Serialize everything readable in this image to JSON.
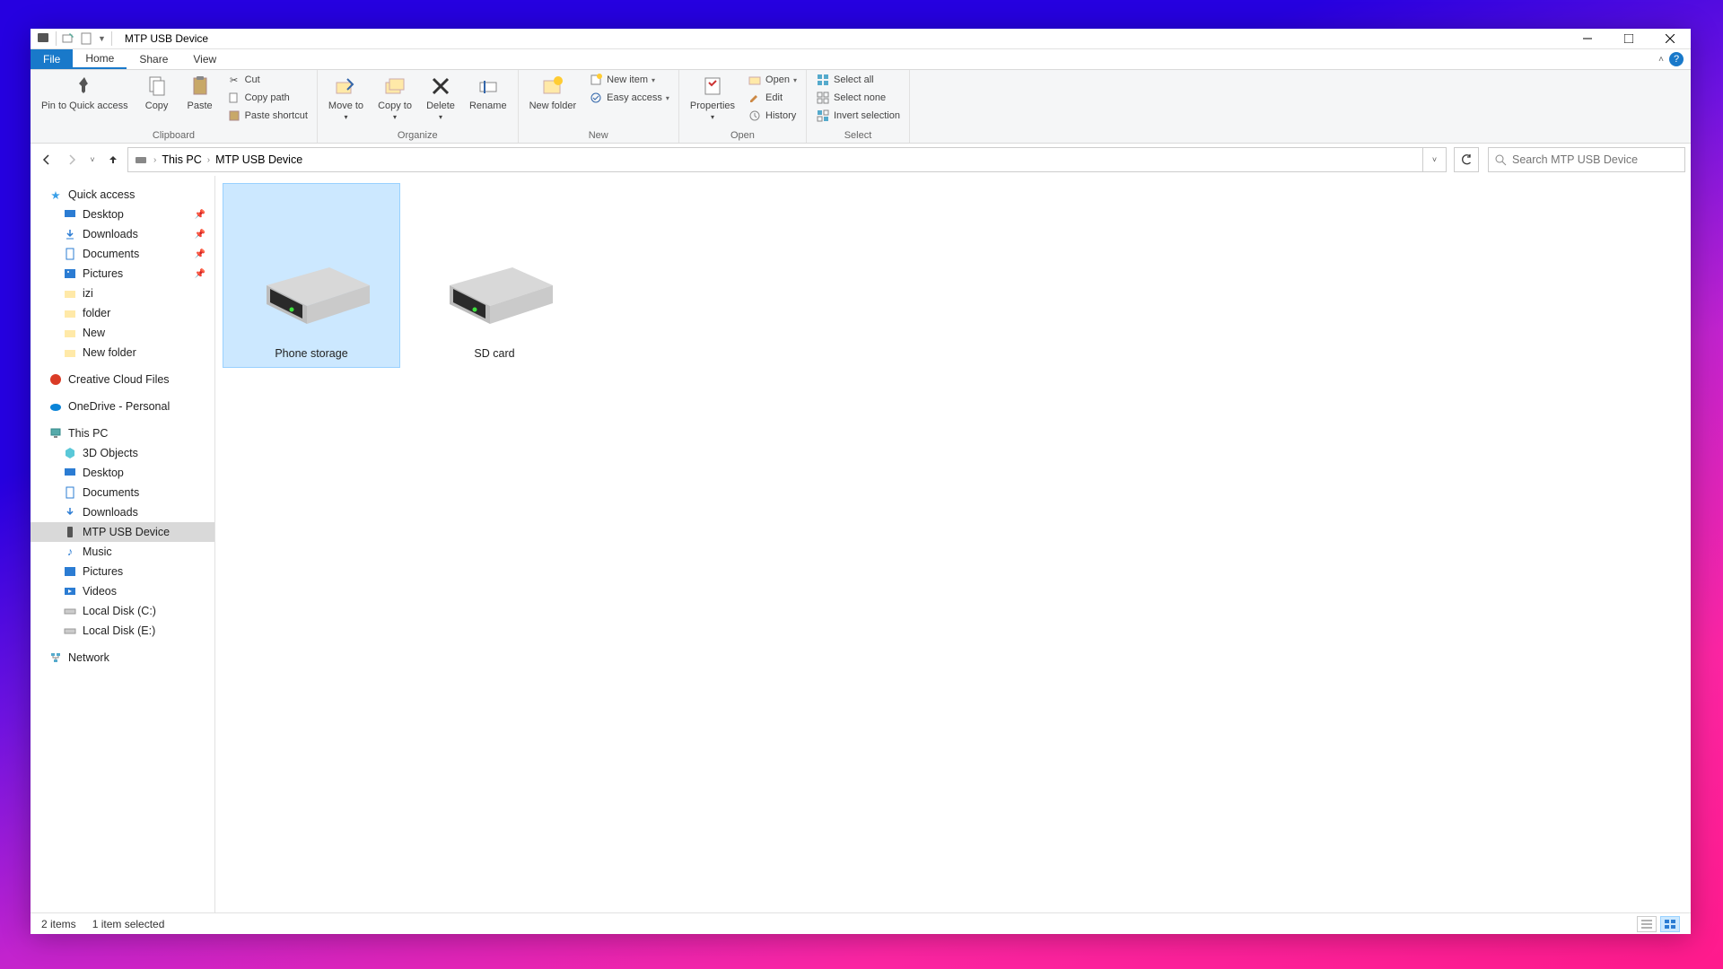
{
  "titlebar": {
    "title": "MTP USB Device"
  },
  "tabs": {
    "file": "File",
    "home": "Home",
    "share": "Share",
    "view": "View"
  },
  "ribbon": {
    "clipboard": {
      "label": "Clipboard",
      "pin": "Pin to Quick access",
      "copy": "Copy",
      "paste": "Paste",
      "cut": "Cut",
      "copypath": "Copy path",
      "pasteshortcut": "Paste shortcut"
    },
    "organize": {
      "label": "Organize",
      "moveto": "Move to",
      "copyto": "Copy to",
      "delete": "Delete",
      "rename": "Rename"
    },
    "new": {
      "label": "New",
      "newfolder": "New folder",
      "newitem": "New item",
      "easyaccess": "Easy access"
    },
    "open": {
      "label": "Open",
      "properties": "Properties",
      "open": "Open",
      "edit": "Edit",
      "history": "History"
    },
    "select": {
      "label": "Select",
      "selectall": "Select all",
      "selectnone": "Select none",
      "invert": "Invert selection"
    }
  },
  "breadcrumb": {
    "root": "This PC",
    "current": "MTP USB Device"
  },
  "search": {
    "placeholder": "Search MTP USB Device"
  },
  "sidebar": {
    "quickaccess": "Quick access",
    "qa_items": [
      {
        "label": "Desktop",
        "pinned": true
      },
      {
        "label": "Downloads",
        "pinned": true
      },
      {
        "label": "Documents",
        "pinned": true
      },
      {
        "label": "Pictures",
        "pinned": true
      },
      {
        "label": "izi",
        "pinned": false
      },
      {
        "label": "folder",
        "pinned": false
      },
      {
        "label": "New",
        "pinned": false
      },
      {
        "label": "New folder",
        "pinned": false
      }
    ],
    "ccfiles": "Creative Cloud Files",
    "onedrive": "OneDrive - Personal",
    "thispc": "This PC",
    "pc_items": [
      "3D Objects",
      "Desktop",
      "Documents",
      "Downloads",
      "MTP USB Device",
      "Music",
      "Pictures",
      "Videos",
      "Local Disk (C:)",
      "Local Disk (E:)"
    ],
    "network": "Network"
  },
  "items": [
    {
      "label": "Phone storage",
      "selected": true
    },
    {
      "label": "SD card",
      "selected": false
    }
  ],
  "status": {
    "count": "2 items",
    "selected": "1 item selected"
  }
}
